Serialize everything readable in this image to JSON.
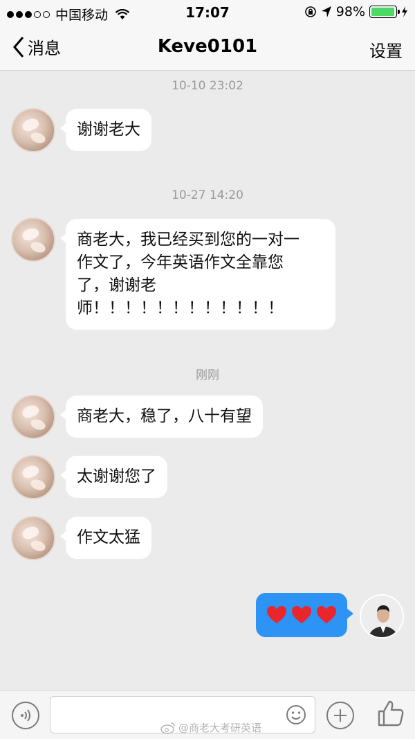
{
  "status_bar": {
    "carrier": "中国移动",
    "time": "17:07",
    "battery_percent": "98%",
    "battery_level": 0.98,
    "signal_bars": 5,
    "signal_filled": 3
  },
  "nav": {
    "back_label": "消息",
    "title": "Keve0101",
    "settings_label": "设置"
  },
  "messages": [
    {
      "timestamp": "10-10 23:02"
    },
    {
      "text": "谢谢老大"
    },
    {
      "timestamp": "10-27 14:20"
    },
    {
      "lines": [
        "商老大，我已经买到您的一对一",
        "作文了，今年英语作文全靠您",
        "了，谢谢老",
        "师！！！！！！！！！！！！"
      ]
    },
    {
      "timestamp": "刚刚"
    },
    {
      "text": "商老大，稳了，八十有望"
    },
    {
      "text": "太谢谢您了"
    },
    {
      "text": "作文太猛"
    },
    {
      "outgoing_hearts": 3
    }
  ],
  "colors": {
    "outgoing_bubble": "#2d93f5",
    "heart": "#e8262c",
    "background": "#ebebeb"
  },
  "input_bar": {
    "voice_icon": "voice-icon",
    "emoji_icon": "emoji-icon",
    "plus_icon": "plus-icon",
    "like_icon": "thumbs-up-icon"
  },
  "watermark": "@商老大考研英语"
}
